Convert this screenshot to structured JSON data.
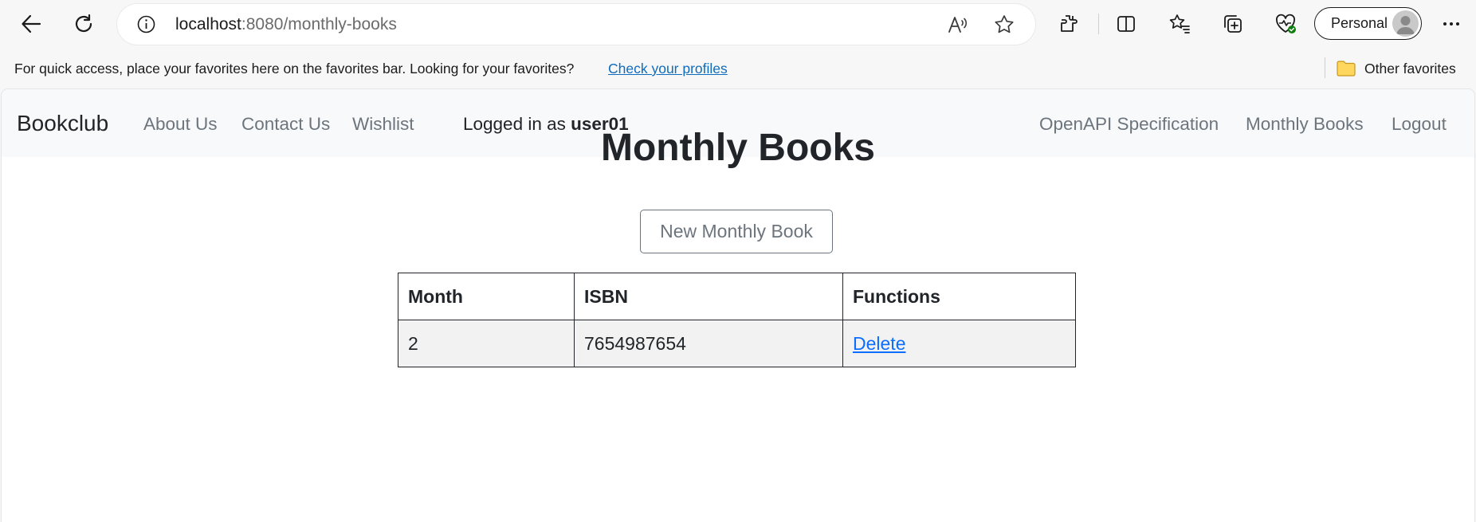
{
  "browser": {
    "url_host": "localhost",
    "url_path": ":8080/monthly-books",
    "profile_label": "Personal",
    "favorites_message": "For quick access, place your favorites here on the favorites bar. Looking for your favorites?",
    "favorites_link": "Check your profiles",
    "other_favorites": "Other favorites",
    "icons": [
      "back-icon",
      "refresh-icon",
      "info-icon",
      "read-aloud-icon",
      "favorite-star-icon",
      "extensions-icon",
      "split-screen-icon",
      "favorites-icon",
      "collections-icon",
      "browser-essentials-icon",
      "more-icon",
      "folder-icon"
    ]
  },
  "navbar": {
    "brand": "Bookclub",
    "links": [
      "About Us",
      "Contact Us",
      "Wishlist"
    ],
    "logged_in_prefix": "Logged in as",
    "username": "user01",
    "right_links": [
      "OpenAPI Specification",
      "Monthly Books",
      "Logout"
    ]
  },
  "main": {
    "title": "Monthly Books",
    "new_button": "New Monthly Book",
    "table": {
      "headers": [
        "Month",
        "ISBN",
        "Functions"
      ],
      "rows": [
        {
          "month": "2",
          "isbn": "7654987654",
          "action": "Delete"
        }
      ]
    }
  },
  "colors": {
    "link_blue": "#0d6efd",
    "navbar_bg": "#f8f9fa",
    "muted_nav": "#6c757d",
    "edge_link": "#0f6cbd"
  }
}
